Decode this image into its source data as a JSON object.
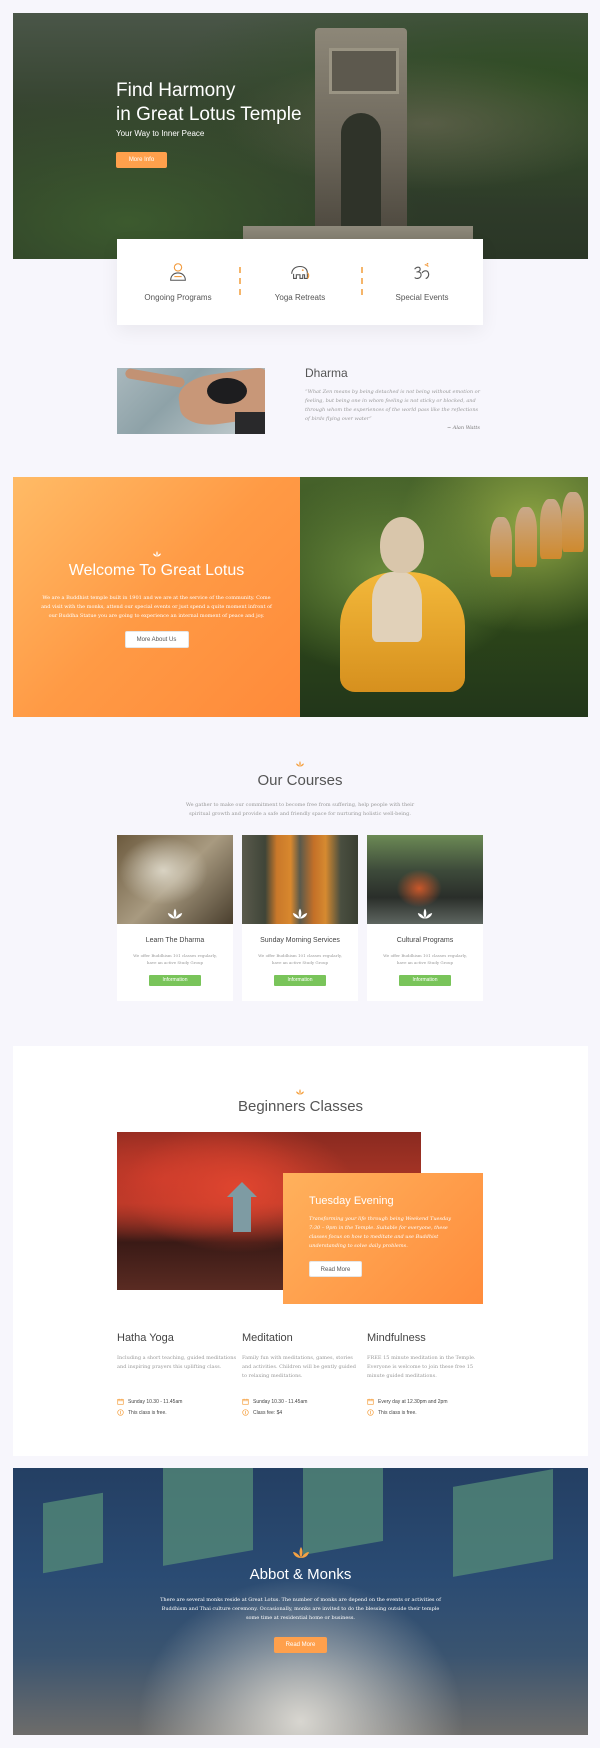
{
  "hero": {
    "title_line1": "Find Harmony",
    "title_line2": "in Great Lotus Temple",
    "subtitle": "Your Way to Inner Peace",
    "button": "More Info"
  },
  "features": [
    {
      "label": "Ongoing Programs",
      "icon": "monk-icon"
    },
    {
      "label": "Yoga Retreats",
      "icon": "elephant-icon"
    },
    {
      "label": "Special Events",
      "icon": "om-icon"
    }
  ],
  "dharma": {
    "title": "Dharma",
    "quote": "“What Zen means by being detached is not being without emotion or feeling, but being one in whom feeling is not sticky or blocked, and through whom the experiences of the world pass like the reflections of birds flying over water”",
    "author": "~ Alan Watts"
  },
  "welcome": {
    "title": "Welcome To Great Lotus",
    "text": "We are a Buddhist temple built in 1901 and we are at the service of the community. Come and visit with the monks, attend our special events or just spend a quite moment infront of our Buddha Statue you are going to experience an internal moment of peace and joy.",
    "button": "More About Us"
  },
  "courses": {
    "title": "Our Courses",
    "intro": "We gather to make our commitment to become free from suffering, help people with their spiritual growth and provide a safe and friendly space for nurturing holistic well-being.",
    "items": [
      {
        "title": "Learn The Dharma",
        "desc": "We offer Buddhism 101 classes regularly, have an active Study Group",
        "button": "Information"
      },
      {
        "title": "Sunday Morning Services",
        "desc": "We offer Buddhism 101 classes regularly, have an active Study Group",
        "button": "Information"
      },
      {
        "title": "Cultural Programs",
        "desc": "We offer Buddhism 101 classes regularly, have an active Study Group",
        "button": "Information"
      }
    ]
  },
  "beginners": {
    "title": "Beginners Classes",
    "feature": {
      "title": "Tuesday Evening",
      "text": "Transforming your life through being Weekend Tuesday 7:30 – 9pm in the Temple. Suitable for everyone, these classes focus on how to meditate and use Buddhist understanding to solve daily problems.",
      "button": "Read More"
    },
    "classes": [
      {
        "title": "Hatha Yoga",
        "desc": "Including a short teaching, guided meditations and inspiring prayers this uplifting class.",
        "time": "Sunday 10.30 - 11.45am",
        "fee": "This class is free."
      },
      {
        "title": "Meditation",
        "desc": "Family fun with meditations, games, stories and activities. Children will be gently guided to relaxing meditations.",
        "time": "Sunday 10.30 - 11.45am",
        "fee": "Class fee: $4"
      },
      {
        "title": "Mindfulness",
        "desc": "FREE 15 minute meditation in the Temple. Everyone is welcome to join these free 15 minute guided meditations.",
        "time": "Every day at 12.30pm and 2pm",
        "fee": "This class is free."
      }
    ]
  },
  "abbot": {
    "title": "Abbot & Monks",
    "text": "There are several monks reside at Great Lotus. The number of monks are depend on the events or activities of Buddhism and Thai culture ceremony. Occasionally, monks are invited to do the blessing outside their temple some time at residential home or business.",
    "button": "Read More"
  },
  "colors": {
    "accent_orange": "#ffa04c",
    "green_button": "#79c45a",
    "background": "#f7f6fc"
  }
}
